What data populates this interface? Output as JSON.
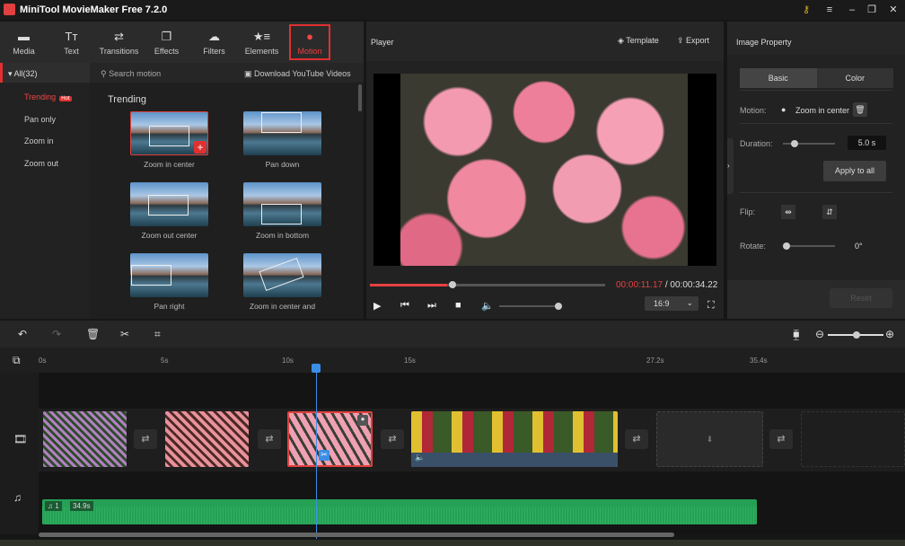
{
  "app": {
    "title": "MiniTool MovieMaker Free 7.2.0"
  },
  "toolbar": {
    "tabs": [
      {
        "label": "Media",
        "icon": "folder-icon"
      },
      {
        "label": "Text",
        "icon": "text-icon"
      },
      {
        "label": "Transitions",
        "icon": "transitions-icon"
      },
      {
        "label": "Effects",
        "icon": "effects-icon"
      },
      {
        "label": "Filters",
        "icon": "filters-icon"
      },
      {
        "label": "Elements",
        "icon": "elements-icon"
      },
      {
        "label": "Motion",
        "icon": "motion-icon",
        "active": true
      }
    ]
  },
  "library": {
    "all_label": "All(32)",
    "search_placeholder": "Search motion",
    "download_label": "Download YouTube Videos",
    "categories": [
      {
        "label": "Trending",
        "badge": "Hot"
      },
      {
        "label": "Pan only"
      },
      {
        "label": "Zoom in"
      },
      {
        "label": "Zoom out"
      }
    ],
    "section_title": "Trending",
    "items": [
      {
        "label": "Zoom in center"
      },
      {
        "label": "Pan down"
      },
      {
        "label": "Zoom out center"
      },
      {
        "label": "Zoom in bottom"
      },
      {
        "label": "Pan right"
      },
      {
        "label": "Zoom in center and"
      }
    ]
  },
  "player": {
    "title": "Player",
    "template_label": "Template",
    "export_label": "Export",
    "current_time": "00:00:11.17",
    "total_time": "/ 00:00:34.22",
    "progress_percent": 33,
    "volume_percent": 100,
    "aspect_ratio": "16:9"
  },
  "property": {
    "title": "Image Property",
    "tabs": [
      "Basic",
      "Color"
    ],
    "motion_label": "Motion:",
    "motion_value": "Zoom in center",
    "duration_label": "Duration:",
    "duration_value": "5.0 s",
    "apply_all": "Apply to all",
    "flip_label": "Flip:",
    "rotate_label": "Rotate:",
    "rotate_value": "0°",
    "reset": "Reset"
  },
  "timeline": {
    "ticks": [
      "0s",
      "5s",
      "10s",
      "15s",
      "27.2s",
      "35.4s"
    ],
    "audio_index": "1",
    "audio_duration": "34.9s"
  },
  "colors": {
    "accent": "#e03030",
    "playhead": "#3a8ee6",
    "audio": "#25a055"
  }
}
